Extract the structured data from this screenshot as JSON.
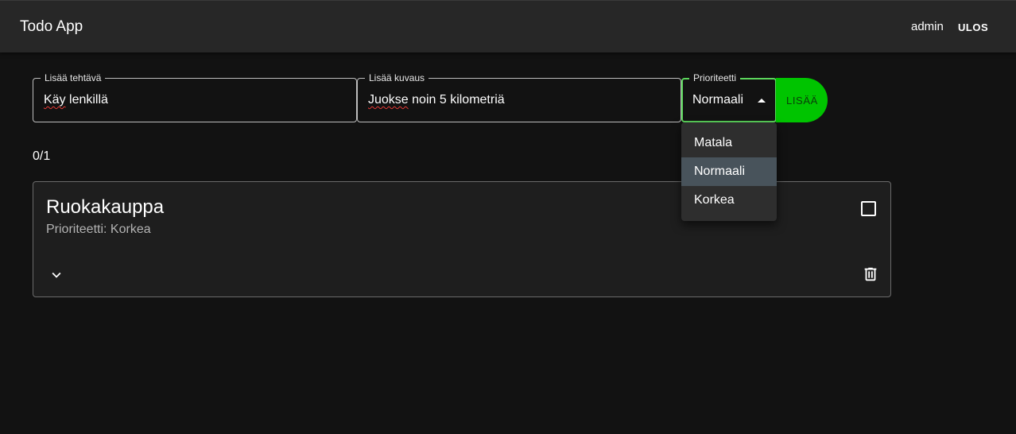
{
  "appbar": {
    "title": "Todo App",
    "user": "admin",
    "logout_label": "ULOS"
  },
  "form": {
    "task": {
      "label": "Lisää tehtävä",
      "value": "Käy lenkillä",
      "misspelled_word": "Käy",
      "rest": " lenkillä"
    },
    "description": {
      "label": "Lisää kuvaus",
      "value": "Juokse noin 5 kilometriä",
      "misspelled_word": "Juokse",
      "rest": " noin 5 kilometriä"
    },
    "priority": {
      "label": "Prioriteetti",
      "value": "Normaali",
      "options": [
        "Matala",
        "Normaali",
        "Korkea"
      ],
      "selected_index": 1
    },
    "add_label": "LISÄÄ"
  },
  "counter": "0/1",
  "todos": [
    {
      "title": "Ruokakauppa",
      "priority_text": "Prioriteetti: Korkea",
      "done": false
    }
  ],
  "colors": {
    "accent": "#00c400",
    "focus_border": "#5cd65c",
    "background": "#121212",
    "appbar": "#272727"
  },
  "icons": {
    "expand": "chevron-down-icon",
    "delete": "trash-icon",
    "check": "checkbox-icon",
    "caret": "caret-up-icon"
  }
}
